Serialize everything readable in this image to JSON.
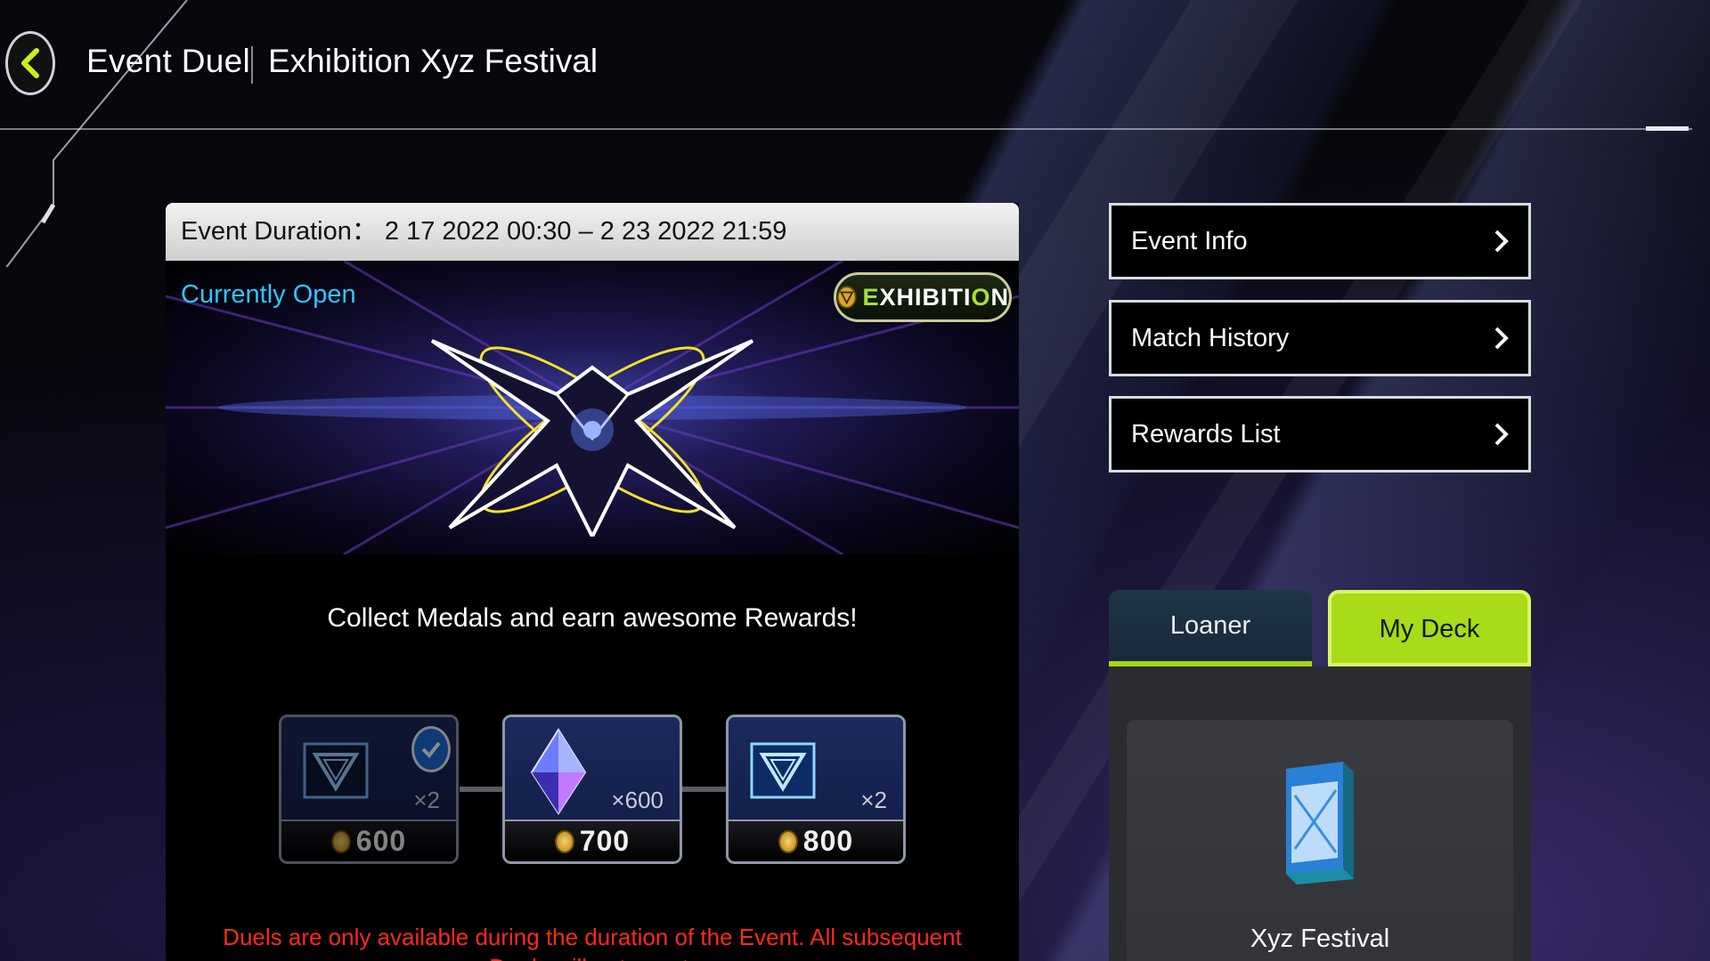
{
  "header": {
    "title": "Event Duel",
    "subtitle": "Exhibition Xyz Festival"
  },
  "event": {
    "duration_label": "Event Duration：",
    "duration_value": "2 17 2022 00:30 – 2 23 2022 21:59",
    "status": "Currently Open",
    "badge_prefix": "E",
    "badge_rest": "XHIBITI",
    "badge_o": "O",
    "badge_end": "N",
    "tagline": "Collect Medals and earn awesome Rewards!",
    "warning": "Duels are only available during the duration of the Event. All subsequent Duels will not count."
  },
  "rewards": [
    {
      "item": "orb-icon",
      "quantity": "×2",
      "cost": "600",
      "claimed": true
    },
    {
      "item": "gem-icon",
      "quantity": "×600",
      "cost": "700",
      "claimed": false
    },
    {
      "item": "orb-icon",
      "quantity": "×2",
      "cost": "800",
      "claimed": false
    }
  ],
  "menu": {
    "event_info": "Event Info",
    "match_history": "Match History",
    "rewards_list": "Rewards List"
  },
  "deck": {
    "tab_loaner": "Loaner",
    "tab_my_deck": "My Deck",
    "active_tab": "My Deck",
    "deck_name": "Xyz Festival"
  },
  "colors": {
    "accent_green": "#a8db18",
    "status_blue": "#2fc6ff",
    "warning_red": "#ff2a1a"
  }
}
